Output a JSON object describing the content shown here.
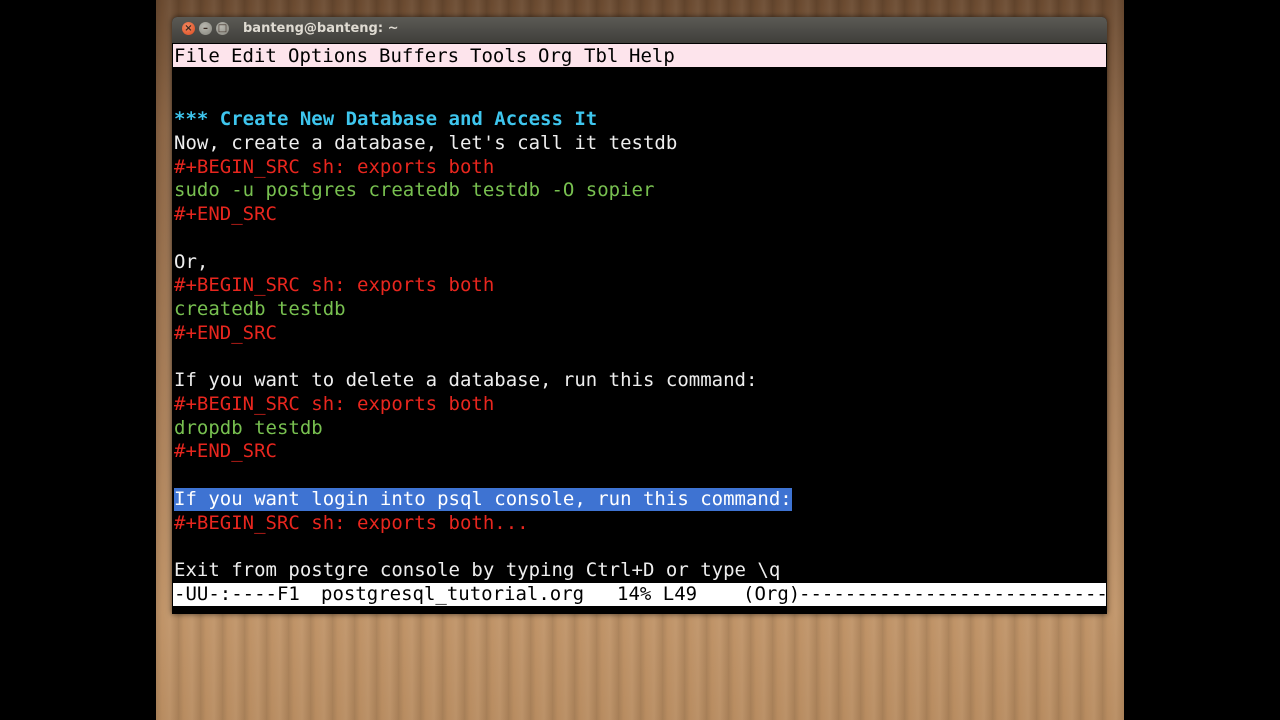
{
  "window": {
    "title": "banteng@banteng: ~"
  },
  "menubar": {
    "items": [
      "File",
      "Edit",
      "Options",
      "Buffers",
      "Tools",
      "Org",
      "Tbl",
      "Help"
    ]
  },
  "buffer": {
    "heading": "*** Create New Database and Access It",
    "line_create": "Now, create a database, let's call it testdb",
    "src_begin_1": "#+BEGIN_SRC sh: exports both",
    "code_1": "sudo -u postgres createdb testdb -O sopier",
    "src_end_1": "#+END_SRC",
    "line_or": "Or,",
    "src_begin_2": "#+BEGIN_SRC sh: exports both",
    "code_2": "createdb testdb",
    "src_end_2": "#+END_SRC",
    "line_delete": "If you want to delete a database, run this command:",
    "src_begin_3": "#+BEGIN_SRC sh: exports both",
    "code_3": "dropdb testdb",
    "src_end_3": "#+END_SRC",
    "line_login": "If you want login into psql console, run this command:",
    "src_begin_4": "#+BEGIN_SRC sh: exports both...",
    "line_exit": "Exit from postgre console by typing Ctrl+D or type \\q"
  },
  "modeline": {
    "status": "-UU-:----F1",
    "filename": "postgresql_tutorial.org",
    "position": "14% L49",
    "mode": "(Org)",
    "dashes": "---------------------------"
  },
  "colors": {
    "heading": "#3ec6ee",
    "keyword": "#e8261e",
    "code": "#78c050",
    "selection": "#3e73d2",
    "menubar": "#fde4ec"
  },
  "icons": {
    "close": "close-icon",
    "minimize": "minimize-icon",
    "maximize": "maximize-icon"
  }
}
